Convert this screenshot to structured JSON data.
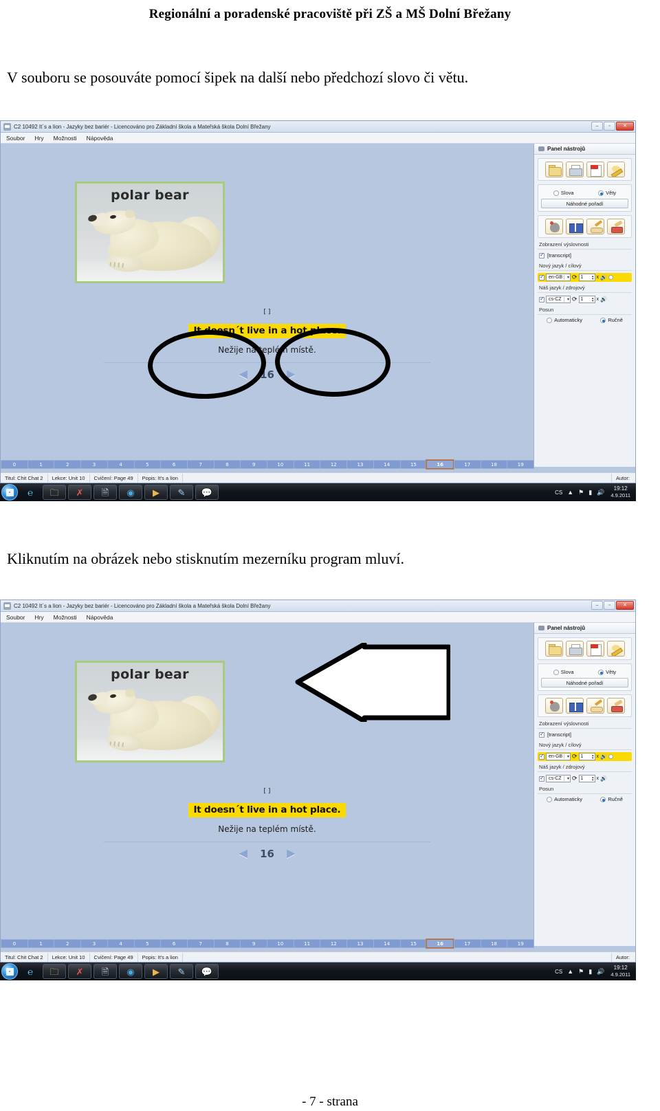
{
  "document": {
    "header": "Regionální a poradenské pracoviště při ZŠ a MŠ Dolní Břežany",
    "paragraph_1": "V souboru se posouváte pomocí šipek na další nebo předchozí slovo či větu.",
    "paragraph_2": "Kliknutím na obrázek nebo stisknutím mezerníku program mluví.",
    "footer": "- 7 - strana"
  },
  "app": {
    "title": "C2 10492 It´s a lion - Jazyky bez bariér - Licencováno pro Základní škola a Mateřská škola Dolní Břežany",
    "window_buttons": {
      "minimize": "–",
      "maximize": "▫",
      "close": "✕"
    },
    "menu": [
      "Soubor",
      "Hry",
      "Možnosti",
      "Nápověda"
    ],
    "card": {
      "word": "polar bear",
      "image_alt": "polar-bear-photo"
    },
    "sentence": {
      "transcript_placeholder": "[ ]",
      "target": "It doesn´t live in a hot place.",
      "source": "Nežije na teplém místě."
    },
    "navigation": {
      "prev_arrow": "◄",
      "next_arrow": "►",
      "index": "16"
    },
    "pages": [
      "0",
      "1",
      "2",
      "3",
      "4",
      "5",
      "6",
      "7",
      "8",
      "9",
      "10",
      "11",
      "12",
      "13",
      "14",
      "15",
      "16",
      "17",
      "18",
      "19"
    ],
    "current_page": "16",
    "statusbar": {
      "title": "Titul: Chit Chat 2",
      "lesson": "Lekce: Unit 10",
      "exercise": "Cvičení: Page 49",
      "description": "Popis: It's a lion",
      "author": "Autor:"
    },
    "toolpanel": {
      "title": "Panel nástrojů",
      "row1_icons": [
        "open-folder-icon",
        "printer-icon",
        "pdf-export-icon",
        "edit-pencil-icon"
      ],
      "mode": {
        "option_words": "Slova",
        "option_sentences": "Věty",
        "selected": "Věty",
        "shuffle_button": "Náhodné pořadí"
      },
      "row2_icons": [
        "mouse-game-icon",
        "book-icon",
        "write-hand-icon",
        "eraser-icon"
      ],
      "pronunciation": {
        "label": "Zobrazení výslovnosti",
        "checkbox_label": "[transcript]",
        "checked": true
      },
      "new_language": {
        "label": "Nový jazyk / cílový",
        "enabled": true,
        "locale": "en-GB",
        "repeat_count": "1",
        "multiplier": "x",
        "highlighted": true
      },
      "our_language": {
        "label": "Náš jazyk / zdrojový",
        "enabled": true,
        "locale": "cs-CZ",
        "repeat_count": "1",
        "multiplier": "x",
        "highlighted": false
      },
      "scroll": {
        "label": "Posun",
        "option_auto": "Automaticky",
        "option_manual": "Ručně",
        "selected": "Ručně"
      }
    }
  },
  "taskbar": {
    "start_label": "start-orb",
    "apps": [
      "internet-explorer-icon",
      "folder-icon",
      "xls-document-icon",
      "document-icon",
      "firefox-icon",
      "media-player-icon",
      "paint-icon",
      "chat-app-icon"
    ],
    "tray": {
      "language": "CS",
      "up_arrow": "▲",
      "flag_icon": "flag-icon",
      "network_icon": "network-icon",
      "volume_icon": "🔊",
      "time": "19:12",
      "date": "4.9.2011"
    }
  },
  "annotations": {
    "ellipse_left": "annotation-ellipse-prev-arrow",
    "ellipse_right": "annotation-ellipse-next-arrow",
    "big_arrow": "annotation-arrow-pointing-to-image"
  }
}
